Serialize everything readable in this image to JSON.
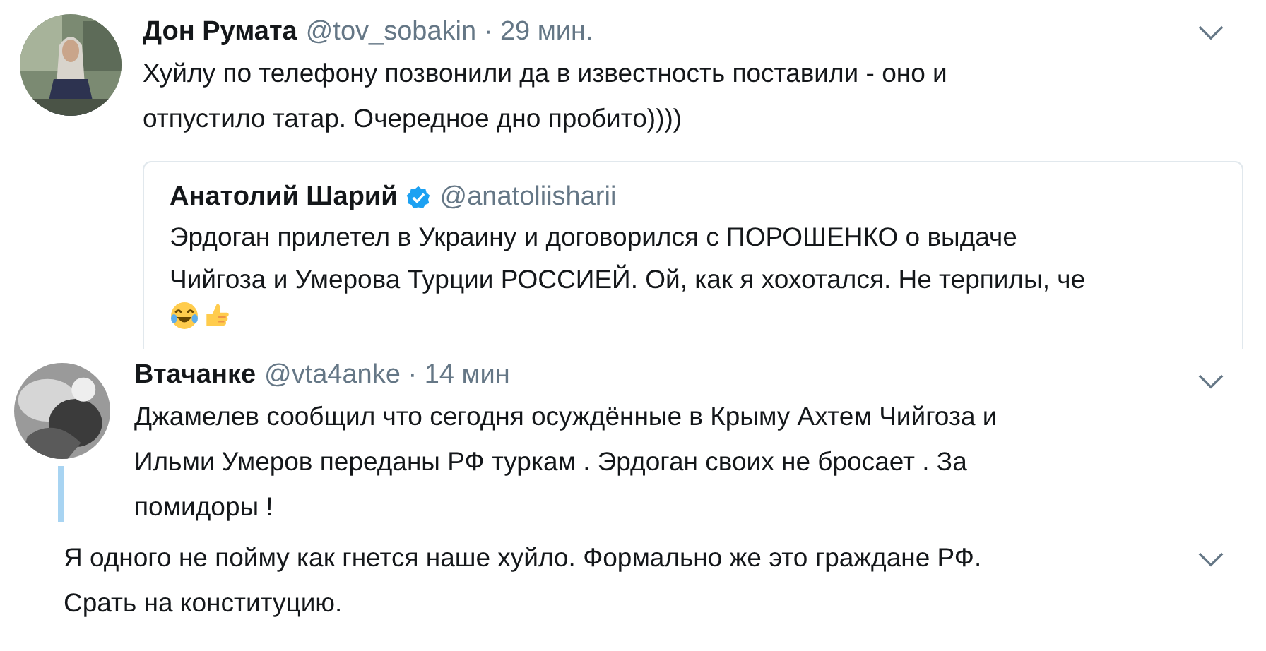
{
  "tweets": [
    {
      "kind": "tweet",
      "name": "Дон Румата",
      "meta": "@tov_sobakin · 29 мин.",
      "lines": [
        "Хуйлу по телефону позвонили да в известность поставили - оно и",
        "отпустило татар. Очередное дно пробито))))"
      ],
      "quote": {
        "name": "Анатолий Шарий",
        "verified": true,
        "handle": "@anatoliisharii",
        "lines": [
          "Эрдоган прилетел в Украину и договорился с ПОРОШЕНКО о выдаче",
          "Чийгоза и Умерова Турции РОССИЕЙ. Ой, как я хохотался. Не терпилы, че"
        ]
      }
    },
    {
      "kind": "tweet",
      "name": "Втачанке",
      "meta": "@vta4anke · 14 мин",
      "lines": [
        "Джамелев сообщил что сегодня осуждённые в Крыму Ахтем Чийгоза и",
        "Ильми Умеров переданы РФ туркам . Эрдоган своих не бросает . За",
        "помидоры !"
      ],
      "thread": true
    },
    {
      "kind": "reply",
      "lines": [
        "Я одного не пойму как гнется наше хуйло. Формально же это граждане РФ.",
        "Срать на конституцию."
      ]
    }
  ]
}
